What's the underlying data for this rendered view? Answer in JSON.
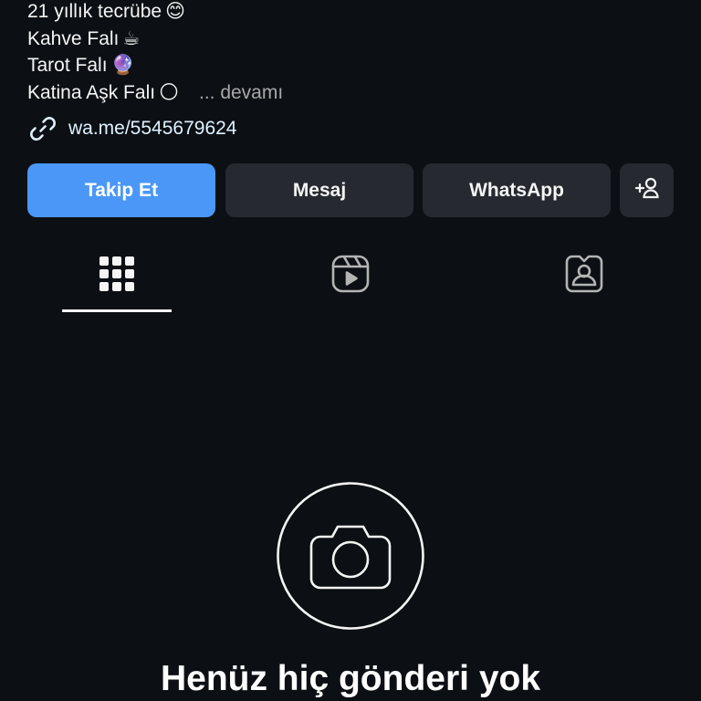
{
  "bio": {
    "lines": [
      {
        "text": "21 yıllık tecrübe",
        "emoji": "😊"
      },
      {
        "text": "Kahve Falı",
        "emoji": "☕"
      },
      {
        "text": "Tarot Falı",
        "emoji": "🔮"
      },
      {
        "text": "Katina Aşk Falı",
        "emoji": "🌕"
      }
    ],
    "more_label": "... devamı",
    "link": {
      "icon": "link-icon",
      "text": "wa.me/5545679624"
    }
  },
  "actions": {
    "follow_label": "Takip Et",
    "message_label": "Mesaj",
    "whatsapp_label": "WhatsApp",
    "suggest_icon": "add-person-icon"
  },
  "tabs": [
    {
      "icon": "grid-icon",
      "selected": true
    },
    {
      "icon": "reels-icon",
      "selected": false
    },
    {
      "icon": "tagged-icon",
      "selected": false
    }
  ],
  "empty_state": {
    "icon": "camera-icon",
    "title": "Henüz hiç gönderi yok"
  },
  "colors": {
    "background": "#0c1014",
    "primary_button": "#4a97f7",
    "secondary_button": "#262a30",
    "link": "#e0f1ff",
    "muted": "#a8a8a8"
  }
}
